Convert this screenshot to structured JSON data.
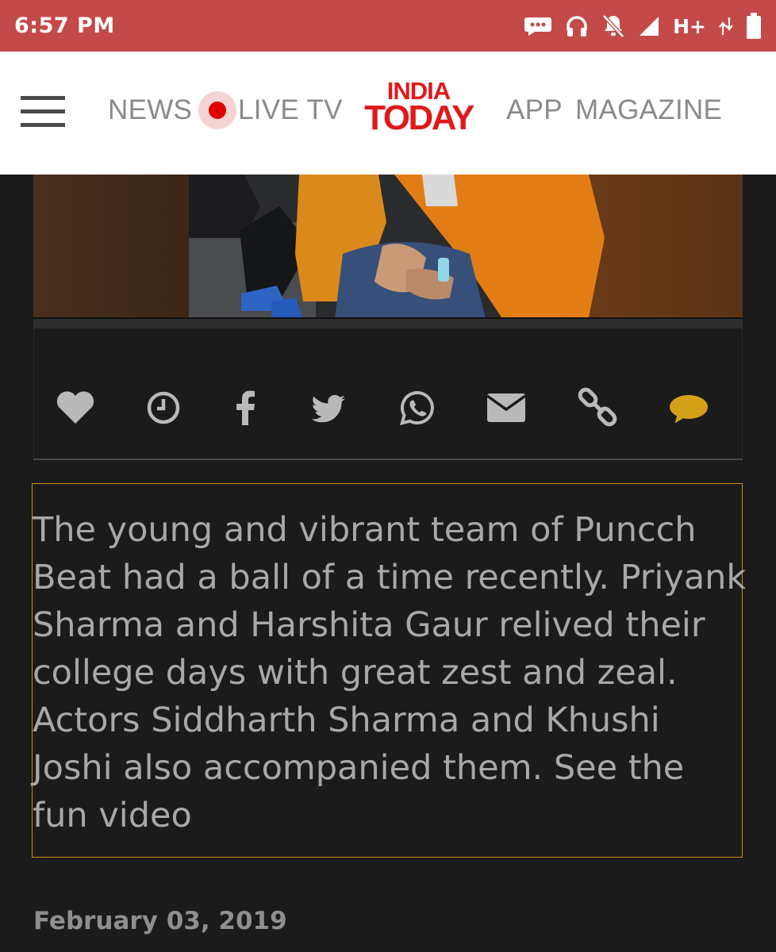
{
  "status_bar": {
    "time": "6:57 PM",
    "network_label": "H+",
    "icons": [
      "message-icon",
      "headphones-icon",
      "bell-off-icon",
      "signal-icon",
      "data-arrows-icon",
      "battery-icon"
    ]
  },
  "header": {
    "nav": {
      "news": "NEWS",
      "live_tv": "LIVE TV",
      "app": "APP",
      "magazine": "MAGAZINE"
    },
    "logo": {
      "line1": "INDIA",
      "line2": "TODAY"
    },
    "colors": {
      "brand_red": "#e01a1a",
      "status_bar": "#c44a4a"
    }
  },
  "share_bar": {
    "icons": [
      "heart-icon",
      "clock-icon",
      "facebook-icon",
      "twitter-icon",
      "whatsapp-icon",
      "email-icon",
      "link-icon",
      "comment-icon"
    ],
    "colors": {
      "icon": "#b9b9b9",
      "comment": "#d4a017"
    }
  },
  "article": {
    "description": "The young and vibrant team of Puncch Beat had a ball of a time recently. Priyank Sharma and Harshita Gaur relived their college days with great zest and zeal. Actors Siddharth Sharma and Khushi Joshi also accompanied them. See the fun video",
    "date": "February 03, 2019"
  }
}
